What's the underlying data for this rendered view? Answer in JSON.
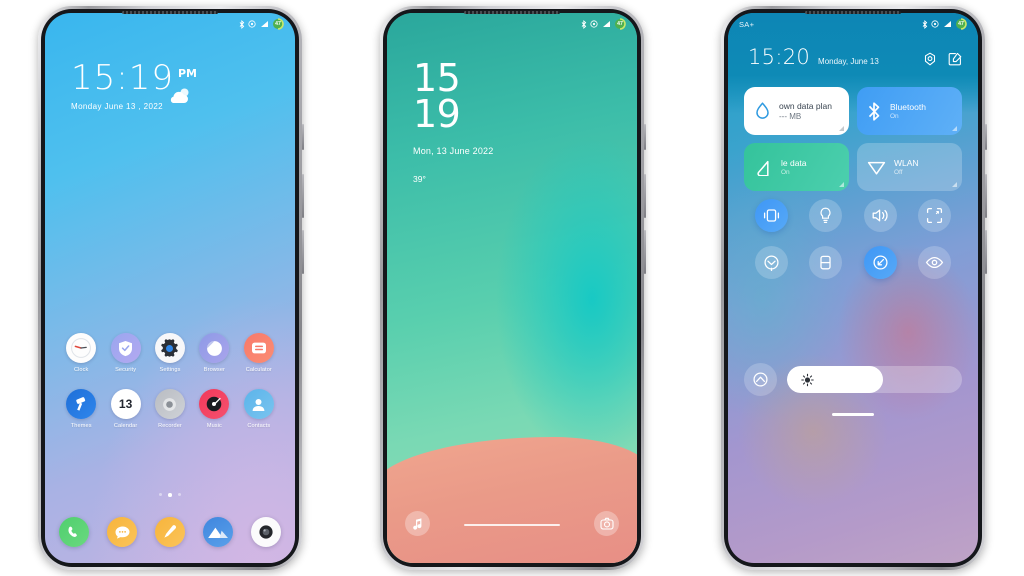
{
  "phone1": {
    "name": "home-screen",
    "statusbar": {
      "carrier": "",
      "battery_level": "47"
    },
    "clock": {
      "time": "15:19",
      "ampm": "PM",
      "date": "Monday  June  13 , 2022"
    },
    "apps": [
      {
        "label": "Clock",
        "icon": "clock-icon"
      },
      {
        "label": "Security",
        "icon": "shield-check-icon"
      },
      {
        "label": "Settings",
        "icon": "gear-icon"
      },
      {
        "label": "Browser",
        "icon": "browser-icon"
      },
      {
        "label": "Calculator",
        "icon": "calculator-icon"
      },
      {
        "label": "Themes",
        "icon": "paint-roller-icon"
      },
      {
        "label": "Calendar",
        "icon": "calendar-icon",
        "day": "13"
      },
      {
        "label": "Recorder",
        "icon": "recorder-icon"
      },
      {
        "label": "Music",
        "icon": "music-vinyl-icon"
      },
      {
        "label": "Contacts",
        "icon": "person-icon"
      }
    ],
    "page_dots": {
      "count": 3,
      "active_index": 1
    },
    "dock": [
      {
        "name": "Phone",
        "icon": "phone-icon"
      },
      {
        "name": "Messages",
        "icon": "message-icon"
      },
      {
        "name": "Notes",
        "icon": "pencil-icon"
      },
      {
        "name": "Gallery",
        "icon": "gallery-mountain-icon"
      },
      {
        "name": "Camera",
        "icon": "camera-icon"
      }
    ]
  },
  "phone2": {
    "name": "lock-screen",
    "statusbar": {
      "battery_level": "47"
    },
    "clock": {
      "hours": "15",
      "minutes": "19",
      "date": "Mon, 13 June 2022",
      "temperature": "39°"
    },
    "shortcuts": [
      {
        "name": "music-shortcut",
        "icon": "music-note-icon"
      },
      {
        "name": "camera-shortcut",
        "icon": "camera-icon"
      }
    ]
  },
  "phone3": {
    "name": "quick-settings",
    "statusbar": {
      "carrier": "SA+",
      "battery_level": "47"
    },
    "header": {
      "time": "15:20",
      "date": "Monday, June 13",
      "actions": [
        {
          "name": "settings-gear-icon"
        },
        {
          "name": "edit-icon"
        }
      ]
    },
    "tiles": [
      {
        "key": "data-plan",
        "title": "own data plan",
        "subtitle": "--- MB",
        "state": "off",
        "icon": "data-drop-icon"
      },
      {
        "key": "bluetooth",
        "title": "Bluetooth",
        "subtitle": "On",
        "state": "on",
        "icon": "bluetooth-icon"
      },
      {
        "key": "mobile-data",
        "title": "le data",
        "subtitle": "On",
        "state": "on",
        "icon": "mobile-data-icon"
      },
      {
        "key": "wlan",
        "title": "WLAN",
        "subtitle": "Off",
        "state": "off",
        "icon": "wifi-icon"
      }
    ],
    "toggles": [
      {
        "name": "vibrate-toggle",
        "icon": "vibrate-icon",
        "state": "on"
      },
      {
        "name": "flashlight-toggle",
        "icon": "flashlight-icon",
        "state": "off"
      },
      {
        "name": "volume-toggle",
        "icon": "speaker-icon",
        "state": "off"
      },
      {
        "name": "screenshot-toggle",
        "icon": "crop-icon",
        "state": "off"
      },
      {
        "name": "auto-rotate-toggle",
        "icon": "rotate-icon",
        "state": "off"
      },
      {
        "name": "battery-saver-toggle",
        "icon": "battery-icon",
        "state": "off"
      },
      {
        "name": "data-saver-toggle",
        "icon": "data-saver-icon",
        "state": "on"
      },
      {
        "name": "eye-care-toggle",
        "icon": "eye-icon",
        "state": "off"
      }
    ],
    "brightness": {
      "icon": "brightness-sun-icon",
      "value_percent": 55,
      "auto_icon": "auto-brightness-icon"
    }
  }
}
